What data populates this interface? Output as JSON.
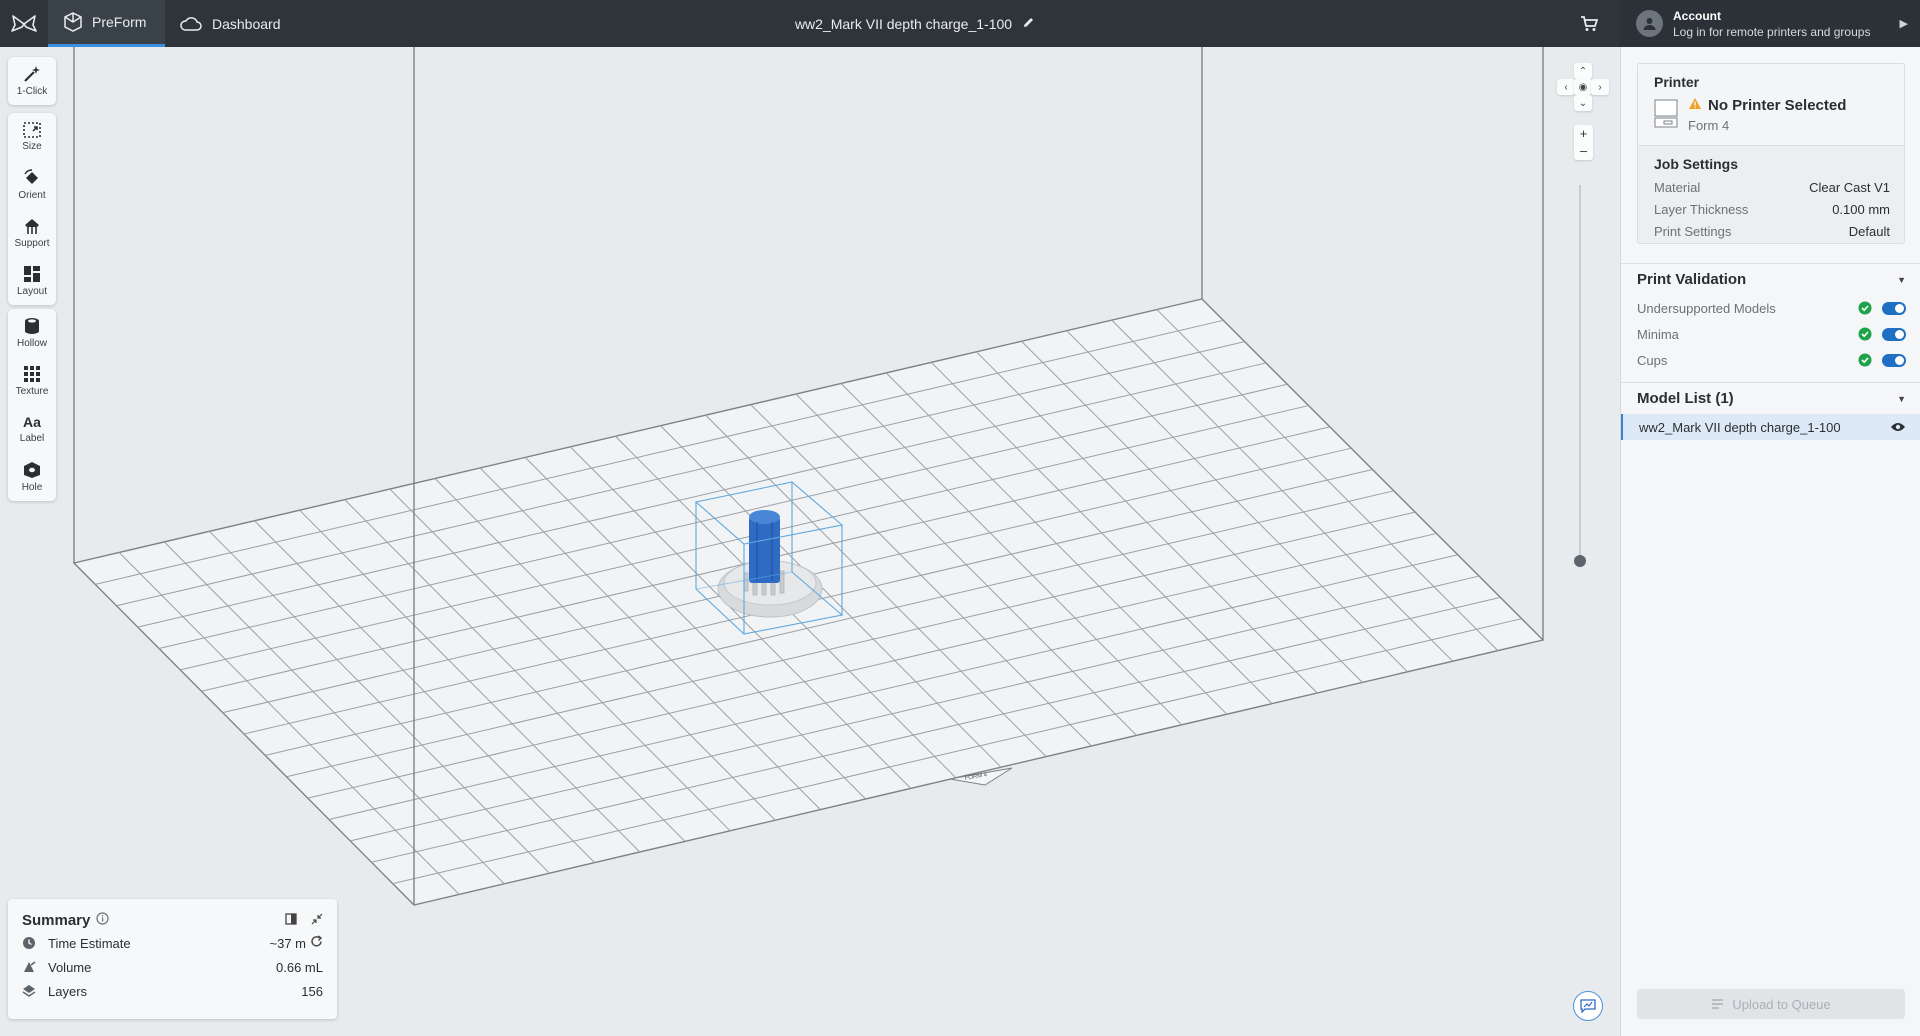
{
  "topbar": {
    "app_tab": "PreForm",
    "dashboard_tab": "Dashboard",
    "file_title": "ww2_Mark VII depth charge_1-100"
  },
  "account": {
    "title": "Account",
    "subtitle": "Log in for remote printers and groups"
  },
  "toolbar": {
    "one_click": "1-Click",
    "size": "Size",
    "orient": "Orient",
    "support": "Support",
    "layout": "Layout",
    "hollow": "Hollow",
    "texture": "Texture",
    "label": "Label",
    "hole": "Hole"
  },
  "summary": {
    "title": "Summary",
    "rows": [
      {
        "label": "Time Estimate",
        "value": "~37 m"
      },
      {
        "label": "Volume",
        "value": "0.66 mL"
      },
      {
        "label": "Layers",
        "value": "156"
      }
    ]
  },
  "printer": {
    "section_title": "Printer",
    "name": "No Printer Selected",
    "model": "Form 4"
  },
  "job_settings": {
    "title": "Job Settings",
    "rows": [
      {
        "label": "Material",
        "value": "Clear Cast V1"
      },
      {
        "label": "Layer Thickness",
        "value": "0.100 mm"
      },
      {
        "label": "Print Settings",
        "value": "Default"
      }
    ]
  },
  "print_validation": {
    "title": "Print Validation",
    "items": [
      "Undersupported Models",
      "Minima",
      "Cups"
    ]
  },
  "model_list": {
    "title": "Model List (1)",
    "items": [
      "ww2_Mark VII depth charge_1-100"
    ]
  },
  "upload_button": "Upload to Queue",
  "build_plate_label": "FORM 4",
  "colors": {
    "topbar": "#2e3439",
    "accent": "#3d8fe0",
    "model_blue": "#2f6bc4",
    "success": "#1fa34a",
    "toggle": "#1f6fc5"
  }
}
